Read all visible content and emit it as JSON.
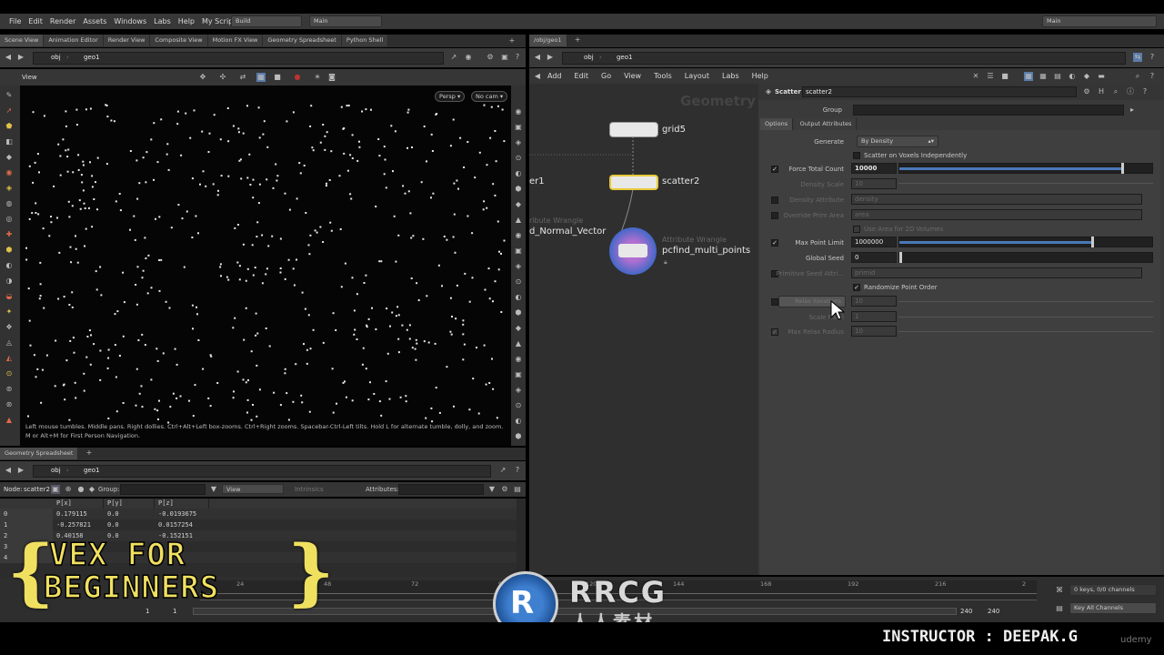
{
  "menubar": {
    "items": [
      "File",
      "Edit",
      "Render",
      "Assets",
      "Windows",
      "Labs",
      "Help",
      "My Scripts"
    ],
    "build_label": "Build",
    "desktop_label": "Main",
    "right_desktop_label": "Main"
  },
  "left_tabs": [
    "Scene View",
    "Animation Editor",
    "Render View",
    "Composite View",
    "Motion FX View",
    "Geometry Spreadsheet",
    "Python Shell"
  ],
  "left_path": [
    "obj",
    "geo1"
  ],
  "viewport": {
    "title": "View",
    "persp_label": "Persp",
    "cam_label": "No cam",
    "help_text_line1": "Left mouse tumbles. Middle pans. Right dollies. Ctrl+Alt+Left box-zooms. Ctrl+Right zooms. Spacebar-Ctrl-Left tilts. Hold L for alternate tumble, dolly, and zoom.",
    "help_text_line2": "M or Alt+M for First Person Navigation."
  },
  "spreadsheet": {
    "tab_label": "Geometry Spreadsheet",
    "path": [
      "obj",
      "geo1"
    ],
    "node_label": "Node:",
    "node_value": "scatter2",
    "group_label": "Group:",
    "view_label": "View",
    "intrinsics_label": "Intrinsics",
    "attributes_label": "Attributes:",
    "columns": [
      "",
      "P[x]",
      "P[y]",
      "P[z]"
    ],
    "rows": [
      [
        "0",
        "0.179115",
        "0.0",
        "-0.0193675"
      ],
      [
        "1",
        "-0.257821",
        "0.0",
        "0.0157254"
      ],
      [
        "2",
        "0.40158",
        "0.0",
        "-0.152151"
      ],
      [
        "3",
        "",
        "",
        ""
      ],
      [
        "4",
        "",
        "",
        ""
      ]
    ]
  },
  "right_pane": {
    "tab_label": "/obj/geo1",
    "path": [
      "obj",
      "geo1"
    ],
    "menu": [
      "Add",
      "Edit",
      "Go",
      "View",
      "Tools",
      "Layout",
      "Labs",
      "Help"
    ],
    "network_watermark": "Geometry",
    "nodes": {
      "grid": "grid5",
      "scatter": "scatter2",
      "left_node": "er1",
      "wrangle_type_left": "ribute Wrangle",
      "wrangle_name_left": "d_Normal_Vector",
      "wrangle_type": "Attribute Wrangle",
      "wrangle_name": "pcfind_multi_points"
    }
  },
  "params": {
    "node_type": "Scatter",
    "node_name": "scatter2",
    "group_label": "Group",
    "tabs": [
      "Options",
      "Output Attributes"
    ],
    "generate_label": "Generate",
    "generate_value": "By Density",
    "scatter_voxels_label": "Scatter on Voxels Independently",
    "force_total_label": "Force Total Count",
    "force_total_value": "10000",
    "force_total_fraction": 0.88,
    "density_scale_label": "Density Scale",
    "density_scale_value": "10",
    "density_attr_label": "Density Attribute",
    "density_attr_value": "density",
    "override_prim_label": "Override Prim Area",
    "override_prim_value": "area",
    "use_area_label": "Use Area for 2D Volumes",
    "max_point_label": "Max Point Limit",
    "max_point_value": "1000000",
    "max_point_fraction": 0.76,
    "global_seed_label": "Global Seed",
    "global_seed_value": "0",
    "prim_seed_label": "Primitive Seed Attri...",
    "prim_seed_value": "primid",
    "randomize_label": "Randomize Point Order",
    "relax_label": "Relax Iterations",
    "relax_value": "10",
    "scale_radii_label": "Scale Radii",
    "scale_radii_value": "1",
    "max_relax_label": "Max Relax Radius",
    "max_relax_value": "10"
  },
  "timeline": {
    "ticks": [
      "24",
      "48",
      "72",
      "96",
      "120",
      "144",
      "168",
      "192",
      "216",
      "2"
    ],
    "frame_start": "1",
    "frame_current": "1",
    "end_a": "240",
    "end_b": "240",
    "keys_label": "0 keys, 0/0 channels",
    "key_all_label": "Key All Channels"
  },
  "overlay": {
    "title_line1": "VEX FOR",
    "title_line2": "BEGINNERS",
    "logo_text": "RRCG",
    "logo_sub": "人人素材",
    "instructor": "INSTRUCTOR : DEEPAK.G",
    "udemy": "udemy"
  }
}
